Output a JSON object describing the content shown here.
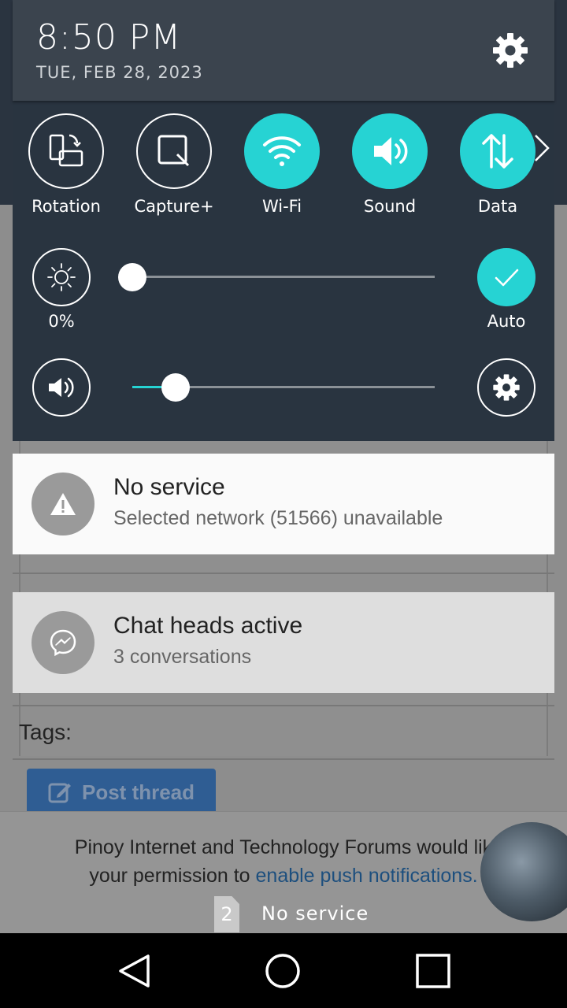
{
  "status": {
    "time": "8:50 PM",
    "date": "TUE, FEB 28, 2023"
  },
  "quick_tiles": [
    {
      "label": "Rotation",
      "active": false,
      "icon": "rotation-icon"
    },
    {
      "label": "Capture+",
      "active": false,
      "icon": "capture-icon"
    },
    {
      "label": "Wi-Fi",
      "active": true,
      "icon": "wifi-icon"
    },
    {
      "label": "Sound",
      "active": true,
      "icon": "sound-icon"
    },
    {
      "label": "Data",
      "active": true,
      "icon": "data-icon"
    }
  ],
  "brightness": {
    "value_label": "0%",
    "level": 0,
    "auto_label": "Auto",
    "auto_enabled": true
  },
  "volume": {
    "level": 0.12
  },
  "notifications": [
    {
      "title": "No service",
      "subtitle": "Selected network (51566) unavailable",
      "icon": "warning-icon"
    },
    {
      "title": "Chat heads active",
      "subtitle": "3 conversations",
      "icon": "messenger-icon"
    }
  ],
  "background_page": {
    "tags_label": "Tags:",
    "post_button_label": "Post thread",
    "push_line1": "Pinoy Internet and Technology Forums would lik",
    "push_line2_prefix": "your permission to ",
    "push_line2_link": "enable push notifications."
  },
  "sim_status": {
    "slot": "2",
    "text": "No service"
  },
  "colors": {
    "accent": "#26d3d3",
    "panel": "#293440",
    "panel_header": "#3b444e"
  }
}
